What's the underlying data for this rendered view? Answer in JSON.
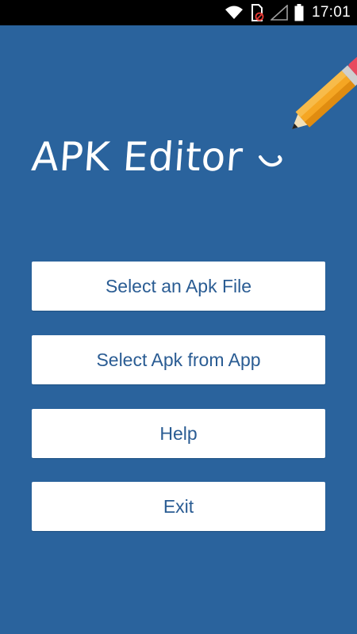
{
  "status_bar": {
    "time": "17:01",
    "icons": [
      "wifi-icon",
      "sim-card-blocked-icon",
      "signal-icon",
      "battery-icon"
    ]
  },
  "app": {
    "logo_text": "APK Editor",
    "background_color": "#2a639d",
    "button_text_color": "#2a5c93"
  },
  "menu": {
    "select_apk_file": "Select an Apk File",
    "select_apk_from_app": "Select Apk from App",
    "help": "Help",
    "exit": "Exit"
  }
}
